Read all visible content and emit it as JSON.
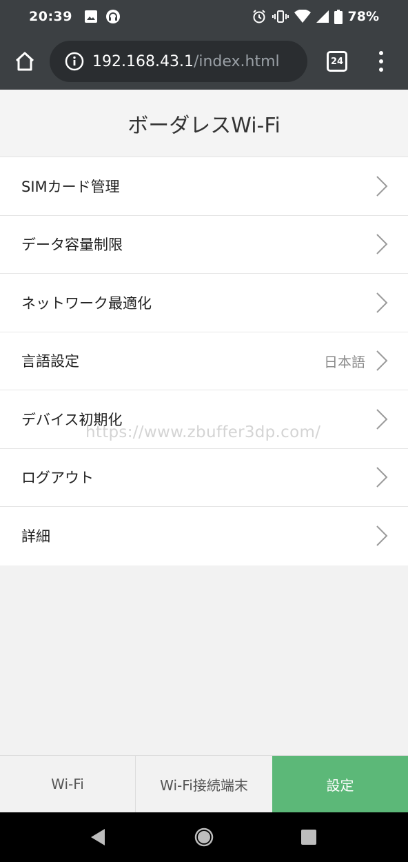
{
  "status_bar": {
    "time": "20:39",
    "battery_percent": "78%",
    "icons_left": [
      "image-icon",
      "headset-icon"
    ],
    "icons_right": [
      "alarm-icon",
      "vibrate-icon",
      "wifi-icon",
      "cell-signal-icon",
      "battery-icon"
    ]
  },
  "browser": {
    "url_host": "192.168.43.1",
    "url_path": "/index.html",
    "tab_count": "24"
  },
  "page": {
    "title": "ボーダレスWi-Fi"
  },
  "menu": {
    "items": [
      {
        "label": "SIMカード管理",
        "value": ""
      },
      {
        "label": "データ容量制限",
        "value": ""
      },
      {
        "label": "ネットワーク最適化",
        "value": ""
      },
      {
        "label": "言語設定",
        "value": "日本語"
      },
      {
        "label": "デバイス初期化",
        "value": ""
      },
      {
        "label": "ログアウト",
        "value": ""
      },
      {
        "label": "詳細",
        "value": ""
      }
    ]
  },
  "watermark": "https://www.zbuffer3dp.com/",
  "bottom_nav": {
    "tabs": [
      {
        "label": "Wi-Fi",
        "active": false
      },
      {
        "label": "Wi-Fi接続端末",
        "active": false
      },
      {
        "label": "設定",
        "active": true
      }
    ]
  },
  "colors": {
    "status_bar_bg": "#3c4043",
    "active_tab_bg": "#5cb878",
    "page_bg": "#f2f2f2"
  }
}
